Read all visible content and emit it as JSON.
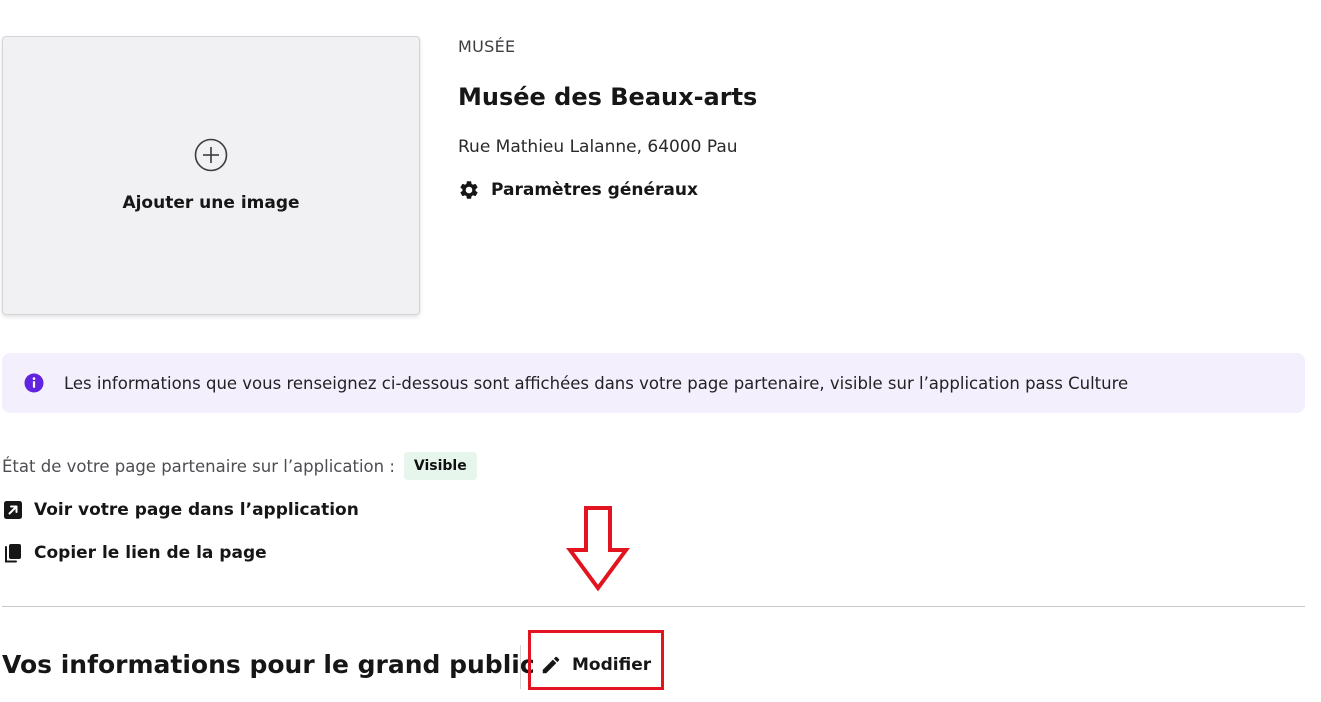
{
  "image_upload": {
    "label": "Ajouter une image",
    "icon": "plus-circle-icon"
  },
  "venue": {
    "type": "MUSÉE",
    "name": "Musée des Beaux-arts",
    "address": "Rue Mathieu Lalanne, 64000 Pau",
    "settings_link": "Paramètres généraux"
  },
  "info_banner": {
    "text": "Les informations que vous renseignez ci-dessous sont affichées dans votre page partenaire, visible sur l’application pass Culture",
    "icon": "info-icon",
    "color": "#6123df"
  },
  "status": {
    "label": "État de votre page partenaire sur l’application :",
    "badge": "Visible"
  },
  "links": {
    "view_page": "Voir votre page dans l’application",
    "copy_link": "Copier le lien de la page"
  },
  "section": {
    "title": "Vos informations pour le grand public",
    "modify_button": "Modifier"
  },
  "annotation": {
    "color": "#e1141f"
  }
}
